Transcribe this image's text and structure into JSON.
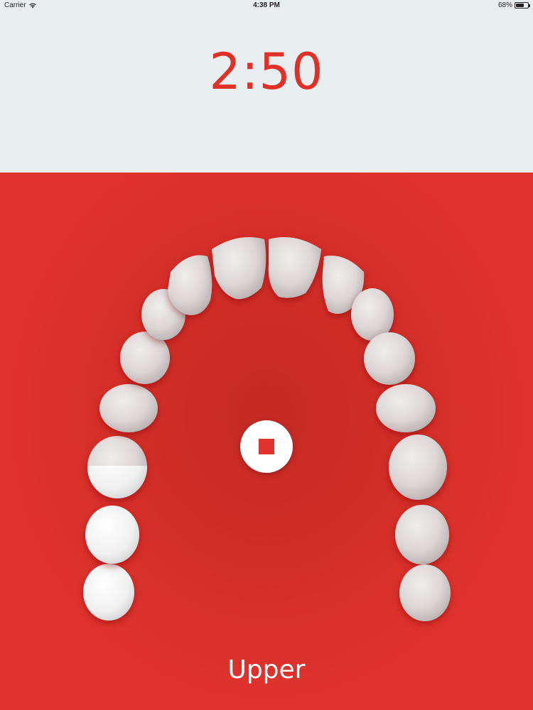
{
  "status": {
    "carrier": "Carrier",
    "time": "4:38 PM",
    "battery": "68%",
    "battery_level": 0.68
  },
  "timer": {
    "value": "2:50"
  },
  "arch": {
    "label": "Upper"
  },
  "colors": {
    "accent": "#e03129",
    "panel_bg": "#e9eef0",
    "tooth": "#e6e1e1",
    "tooth_brushed": "#ffffff"
  },
  "icons": {
    "wifi": "wifi-icon",
    "battery": "battery-icon",
    "stop": "stop-icon"
  }
}
